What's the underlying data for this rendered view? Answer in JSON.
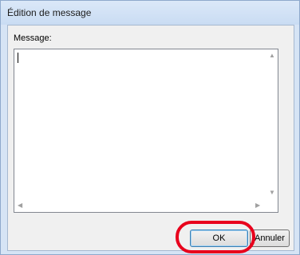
{
  "window": {
    "title": "Édition de message"
  },
  "dialog": {
    "message_label": "Message:",
    "message_value": "",
    "ok_label": "OK",
    "cancel_label": "Annuler"
  },
  "annotation": {
    "highlight_color": "#e8001c",
    "highlight_target": "ok-button"
  },
  "icons": {
    "scroll_up": "scroll-up-icon",
    "scroll_down": "scroll-down-icon",
    "scroll_left": "scroll-left-icon",
    "scroll_right": "scroll-right-icon"
  }
}
